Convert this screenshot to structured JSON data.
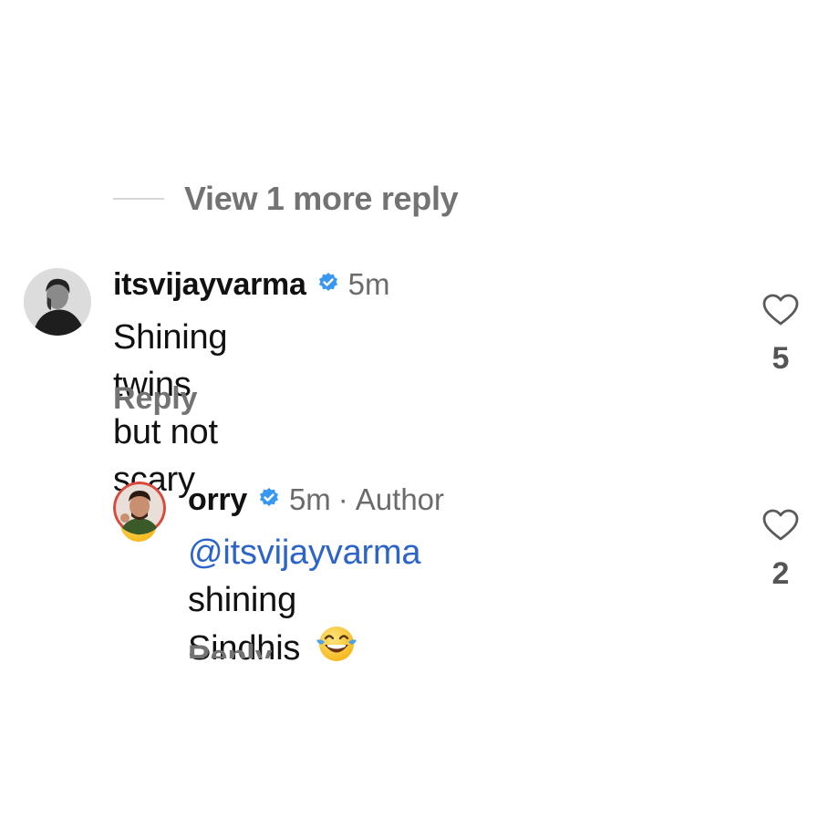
{
  "view_more": {
    "label": "View 1 more reply"
  },
  "comments": [
    {
      "username": "itsvijayvarma",
      "time": "5m",
      "text": "Shining twins but not scary",
      "emoji": "relieved-face-emoji",
      "reply_label": "Reply",
      "likes": "5"
    },
    {
      "username": "orry",
      "time": "5m",
      "separator": "·",
      "author_tag": "Author",
      "mention": "@itsvijayvarma",
      "text_line1": "shining",
      "text_line2": "Sindhis",
      "emoji": "tears-of-joy-emoji",
      "reply_label": "Reply",
      "likes": "2"
    }
  ],
  "colors": {
    "verified_blue": "#3897f0",
    "mention_blue": "#2c64c9",
    "muted_gray": "#737373"
  }
}
